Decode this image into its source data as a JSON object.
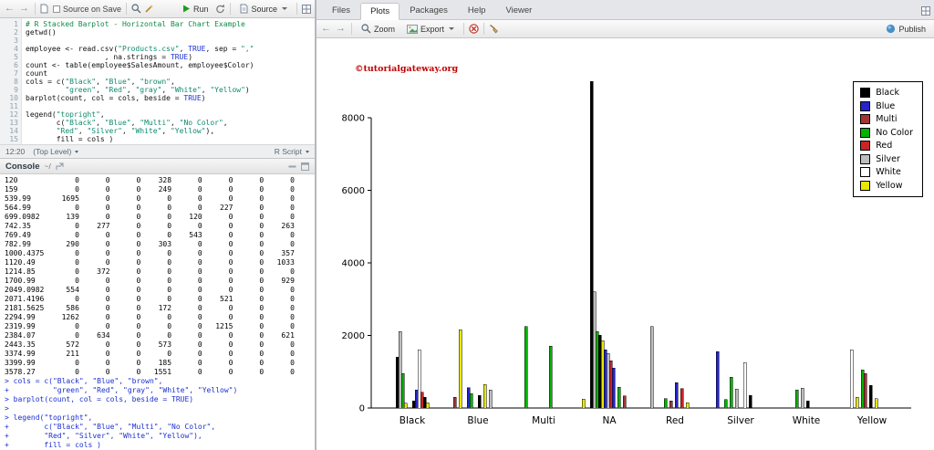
{
  "source_pane": {
    "toolbar": {
      "source_on_save_label": "Source on Save",
      "run_label": "Run",
      "source_label": "Source"
    },
    "code_lines": [
      "# R Stacked Barplot - Horizontal Bar Chart Example",
      "getwd()",
      "",
      "employee <- read.csv(\"Products.csv\", TRUE, sep = \",\"",
      "                  , na.strings = TRUE)",
      "count <- table(employee$SalesAmount, employee$Color)",
      "count",
      "cols = c(\"Black\", \"Blue\", \"brown\",",
      "         \"green\", \"Red\", \"gray\", \"White\", \"Yellow\")",
      "barplot(count, col = cols, beside = TRUE)",
      "",
      "legend(\"topright\",",
      "       c(\"Black\", \"Blue\", \"Multi\", \"No Color\",",
      "       \"Red\", \"Silver\", \"White\", \"Yellow\"),",
      "       fill = cols )"
    ],
    "status": {
      "cursor": "12:20",
      "scope": "(Top Level)",
      "file_type": "R Script"
    }
  },
  "console_pane": {
    "title": "Console",
    "path": "~/",
    "table_rows": [
      [
        "120",
        0,
        0,
        0,
        328,
        0,
        0,
        0,
        0
      ],
      [
        "159",
        0,
        0,
        0,
        249,
        0,
        0,
        0,
        0
      ],
      [
        "539.99",
        1695,
        0,
        0,
        0,
        0,
        0,
        0,
        0
      ],
      [
        "564.99",
        0,
        0,
        0,
        0,
        0,
        227,
        0,
        0
      ],
      [
        "699.0982",
        139,
        0,
        0,
        0,
        120,
        0,
        0,
        0
      ],
      [
        "742.35",
        0,
        277,
        0,
        0,
        0,
        0,
        0,
        263
      ],
      [
        "769.49",
        0,
        0,
        0,
        0,
        543,
        0,
        0,
        0
      ],
      [
        "782.99",
        290,
        0,
        0,
        303,
        0,
        0,
        0,
        0
      ],
      [
        "1000.4375",
        0,
        0,
        0,
        0,
        0,
        0,
        0,
        357
      ],
      [
        "1120.49",
        0,
        0,
        0,
        0,
        0,
        0,
        0,
        1033
      ],
      [
        "1214.85",
        0,
        372,
        0,
        0,
        0,
        0,
        0,
        0
      ],
      [
        "1700.99",
        0,
        0,
        0,
        0,
        0,
        0,
        0,
        929
      ],
      [
        "2049.0982",
        554,
        0,
        0,
        0,
        0,
        0,
        0,
        0
      ],
      [
        "2071.4196",
        0,
        0,
        0,
        0,
        0,
        521,
        0,
        0
      ],
      [
        "2181.5625",
        586,
        0,
        0,
        172,
        0,
        0,
        0,
        0
      ],
      [
        "2294.99",
        1262,
        0,
        0,
        0,
        0,
        0,
        0,
        0
      ],
      [
        "2319.99",
        0,
        0,
        0,
        0,
        0,
        1215,
        0,
        0
      ],
      [
        "2384.07",
        0,
        634,
        0,
        0,
        0,
        0,
        0,
        621
      ],
      [
        "2443.35",
        572,
        0,
        0,
        573,
        0,
        0,
        0,
        0
      ],
      [
        "3374.99",
        211,
        0,
        0,
        0,
        0,
        0,
        0,
        0
      ],
      [
        "3399.99",
        0,
        0,
        0,
        185,
        0,
        0,
        0,
        0
      ],
      [
        "3578.27",
        0,
        0,
        0,
        1551,
        0,
        0,
        0,
        0
      ]
    ],
    "input_lines": [
      "> cols = c(\"Black\", \"Blue\", \"brown\",",
      "+          \"green\", \"Red\", \"gray\", \"White\", \"Yellow\")",
      "> barplot(count, col = cols, beside = TRUE)",
      "> ",
      "> legend(\"topright\",",
      "+        c(\"Black\", \"Blue\", \"Multi\", \"No Color\",",
      "+        \"Red\", \"Silver\", \"White\", \"Yellow\"),",
      "+        fill = cols )"
    ]
  },
  "right_pane": {
    "tabs": [
      "Files",
      "Plots",
      "Packages",
      "Help",
      "Viewer"
    ],
    "active_tab": "Plots",
    "toolbar": {
      "zoom_label": "Zoom",
      "export_label": "Export",
      "publish_label": "Publish"
    }
  },
  "chart_data": {
    "type": "bar",
    "title": "",
    "xlabel": "",
    "ylabel": "",
    "watermark": "©tutorialgateway.org",
    "watermark_color": "#C00000",
    "ylim": [
      0,
      9000
    ],
    "yticks": [
      0,
      2000,
      4000,
      6000,
      8000
    ],
    "grid": false,
    "legend_position": "topright",
    "slots_per_group": 22,
    "categories": [
      "Black",
      "Blue",
      "Multi",
      "NA",
      "Red",
      "Silver",
      "White",
      "Yellow"
    ],
    "colors": {
      "black": "#000000",
      "blue": "#2424CC",
      "brown": "#A33535",
      "green": "#00B400",
      "red": "#CC2424",
      "gray": "#BEBEBE",
      "white": "#FFFFFF",
      "yellow": "#E8E800"
    },
    "legend": [
      {
        "label": "Black",
        "color": "black"
      },
      {
        "label": "Blue",
        "color": "blue"
      },
      {
        "label": "Multi",
        "color": "brown"
      },
      {
        "label": "No Color",
        "color": "green"
      },
      {
        "label": "Red",
        "color": "red"
      },
      {
        "label": "Silver",
        "color": "gray"
      },
      {
        "label": "White",
        "color": "white"
      },
      {
        "label": "Yellow",
        "color": "yellow"
      }
    ],
    "groups": [
      {
        "category": "Black",
        "bars": [
          {
            "slot": 5,
            "value": 1400,
            "color": "black"
          },
          {
            "slot": 6,
            "value": 2100,
            "color": "gray"
          },
          {
            "slot": 7,
            "value": 950,
            "color": "green"
          },
          {
            "slot": 8,
            "value": 130,
            "color": "yellow"
          },
          {
            "slot": 11,
            "value": 200,
            "color": "black"
          },
          {
            "slot": 12,
            "value": 500,
            "color": "blue"
          },
          {
            "slot": 13,
            "value": 1600,
            "color": "white"
          },
          {
            "slot": 14,
            "value": 430,
            "color": "red"
          },
          {
            "slot": 15,
            "value": 300,
            "color": "black"
          },
          {
            "slot": 16,
            "value": 140,
            "color": "yellow"
          }
        ]
      },
      {
        "category": "Blue",
        "bars": [
          {
            "slot": 2,
            "value": 300,
            "color": "brown"
          },
          {
            "slot": 4,
            "value": 2150,
            "color": "yellow"
          },
          {
            "slot": 7,
            "value": 560,
            "color": "blue"
          },
          {
            "slot": 8,
            "value": 400,
            "color": "green"
          },
          {
            "slot": 11,
            "value": 350,
            "color": "black"
          },
          {
            "slot": 13,
            "value": 650,
            "color": "yellow"
          },
          {
            "slot": 15,
            "value": 500,
            "color": "gray"
          }
        ]
      },
      {
        "category": "Multi",
        "bars": [
          {
            "slot": 4,
            "value": 2250,
            "color": "green"
          },
          {
            "slot": 13,
            "value": 1700,
            "color": "green"
          }
        ]
      },
      {
        "category": "NA",
        "bars": [
          {
            "slot": 1,
            "value": 250,
            "color": "yellow"
          },
          {
            "slot": 4,
            "value": 9000,
            "color": "black"
          },
          {
            "slot": 5,
            "value": 3200,
            "color": "gray"
          },
          {
            "slot": 6,
            "value": 2100,
            "color": "green"
          },
          {
            "slot": 7,
            "value": 2000,
            "color": "black"
          },
          {
            "slot": 8,
            "value": 1850,
            "color": "yellow"
          },
          {
            "slot": 9,
            "value": 1600,
            "color": "blue"
          },
          {
            "slot": 10,
            "value": 1500,
            "color": "gray"
          },
          {
            "slot": 11,
            "value": 1300,
            "color": "red"
          },
          {
            "slot": 12,
            "value": 1100,
            "color": "blue"
          },
          {
            "slot": 14,
            "value": 570,
            "color": "green"
          },
          {
            "slot": 16,
            "value": 330,
            "color": "brown"
          }
        ]
      },
      {
        "category": "Red",
        "bars": [
          {
            "slot": 2,
            "value": 2250,
            "color": "gray"
          },
          {
            "slot": 7,
            "value": 260,
            "color": "green"
          },
          {
            "slot": 9,
            "value": 200,
            "color": "brown"
          },
          {
            "slot": 11,
            "value": 700,
            "color": "blue"
          },
          {
            "slot": 13,
            "value": 540,
            "color": "red"
          },
          {
            "slot": 15,
            "value": 150,
            "color": "yellow"
          }
        ]
      },
      {
        "category": "Silver",
        "bars": [
          {
            "slot": 2,
            "value": 1550,
            "color": "blue"
          },
          {
            "slot": 5,
            "value": 230,
            "color": "green"
          },
          {
            "slot": 7,
            "value": 850,
            "color": "green"
          },
          {
            "slot": 9,
            "value": 520,
            "color": "gray"
          },
          {
            "slot": 12,
            "value": 1250,
            "color": "white"
          },
          {
            "slot": 14,
            "value": 350,
            "color": "black"
          }
        ]
      },
      {
        "category": "White",
        "bars": [
          {
            "slot": 7,
            "value": 500,
            "color": "green"
          },
          {
            "slot": 9,
            "value": 550,
            "color": "gray"
          },
          {
            "slot": 11,
            "value": 190,
            "color": "black"
          }
        ]
      },
      {
        "category": "Yellow",
        "bars": [
          {
            "slot": 3,
            "value": 1600,
            "color": "white"
          },
          {
            "slot": 5,
            "value": 300,
            "color": "yellow"
          },
          {
            "slot": 7,
            "value": 1050,
            "color": "green"
          },
          {
            "slot": 8,
            "value": 950,
            "color": "brown"
          },
          {
            "slot": 10,
            "value": 620,
            "color": "black"
          },
          {
            "slot": 12,
            "value": 260,
            "color": "yellow"
          }
        ]
      }
    ]
  }
}
